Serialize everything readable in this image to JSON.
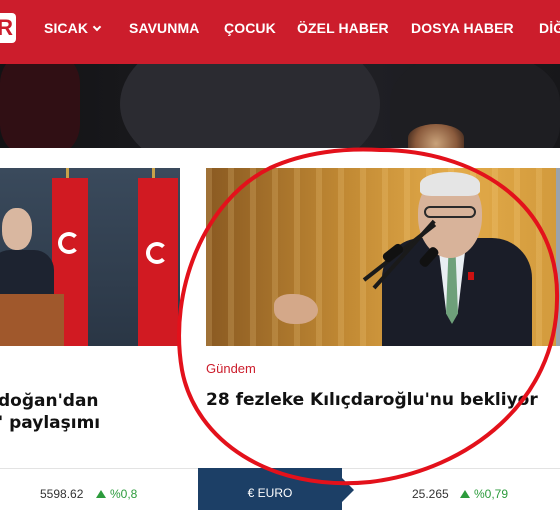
{
  "nav": {
    "logo_letter": "R",
    "items": [
      {
        "label": "SICAK"
      },
      {
        "label": "SAVUNMA"
      },
      {
        "label": "ÇOCUK"
      },
      {
        "label": "ÖZEL HABER"
      },
      {
        "label": "DOSYA HABER"
      },
      {
        "label": "DİĞ"
      }
    ],
    "colors": {
      "bar": "#cc1d2c",
      "text": "#ffffff"
    }
  },
  "cards": [
    {
      "headline_line1": "doğan'dan",
      "headline_line2": "' paylaşımı",
      "image": "erdogan-flags-photo"
    },
    {
      "category": "Gündem",
      "headline": "28 fezleke Kılıçdaroğlu'nu bekliyor",
      "image": "kilicdaroglu-speech-photo",
      "category_color": "#cc1d2c"
    }
  ],
  "annotation": {
    "shape": "circle",
    "color": "#e3111b"
  },
  "ticker": {
    "left_value": "5598.62",
    "left_change": "%0,8",
    "active_tab": "€ EURO",
    "right_value": "25.265",
    "right_change": "%0,79",
    "up_color": "#2c9b3c",
    "tab_color": "#1c3f66"
  }
}
